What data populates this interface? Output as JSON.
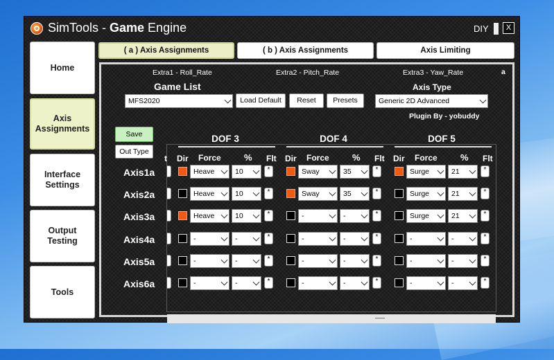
{
  "window": {
    "title_part1": "SimTools - ",
    "title_part2": "Game",
    "title_part3": " Engine",
    "diy_label": "DIY",
    "close_label": "X",
    "accent_color": "#f25a14"
  },
  "sidebar": {
    "items": [
      {
        "label": "Home"
      },
      {
        "label": "Axis Assignments"
      },
      {
        "label": "Interface Settings"
      },
      {
        "label": "Output Testing"
      },
      {
        "label": "Tools"
      }
    ]
  },
  "tabs": [
    {
      "label": "( a ) Axis Assignments",
      "active": true
    },
    {
      "label": "( b ) Axis Assignments",
      "active": false
    },
    {
      "label": "Axis Limiting",
      "active": false
    }
  ],
  "extras": {
    "extra1": "Extra1 - Roll_Rate",
    "extra2": "Extra2 - Pitch_Rate",
    "extra3": "Extra3 - Yaw_Rate",
    "corner": "a"
  },
  "game_list": {
    "label": "Game List",
    "value": "MFS2020",
    "load_default": "Load Default",
    "reset": "Reset",
    "presets": "Presets"
  },
  "axis_type": {
    "label": "Axis Type",
    "value": "Generic 2D Advanced",
    "plugin_by": "Plugin By - yobuddy"
  },
  "buttons": {
    "save": "Save",
    "out_type": "Out Type"
  },
  "columns": {
    "dir": "Dir",
    "force": "Force",
    "percent": "%",
    "flt": "Flt",
    "cut": "t"
  },
  "dofs": [
    "DOF 3",
    "DOF 4",
    "DOF 5"
  ],
  "flt_symbol": "*",
  "axes": [
    {
      "label": "Axis1a",
      "cells": [
        {
          "dir": true,
          "force": "Heave",
          "pct": "10"
        },
        {
          "dir": true,
          "force": "Sway",
          "pct": "35"
        },
        {
          "dir": true,
          "force": "Surge",
          "pct": "21"
        }
      ]
    },
    {
      "label": "Axis2a",
      "cells": [
        {
          "dir": false,
          "force": "Heave",
          "pct": "10"
        },
        {
          "dir": true,
          "force": "Sway",
          "pct": "35"
        },
        {
          "dir": false,
          "force": "Surge",
          "pct": "21"
        }
      ]
    },
    {
      "label": "Axis3a",
      "cells": [
        {
          "dir": true,
          "force": "Heave",
          "pct": "10"
        },
        {
          "dir": false,
          "force": "-",
          "pct": "-"
        },
        {
          "dir": false,
          "force": "Surge",
          "pct": "21"
        }
      ]
    },
    {
      "label": "Axis4a",
      "cells": [
        {
          "dir": false,
          "force": "-",
          "pct": "-"
        },
        {
          "dir": false,
          "force": "-",
          "pct": "-"
        },
        {
          "dir": false,
          "force": "-",
          "pct": "-"
        }
      ]
    },
    {
      "label": "Axis5a",
      "cells": [
        {
          "dir": false,
          "force": "-",
          "pct": "-"
        },
        {
          "dir": false,
          "force": "-",
          "pct": "-"
        },
        {
          "dir": false,
          "force": "-",
          "pct": "-"
        }
      ]
    },
    {
      "label": "Axis6a",
      "cells": [
        {
          "dir": false,
          "force": "-",
          "pct": "-"
        },
        {
          "dir": false,
          "force": "-",
          "pct": "-"
        },
        {
          "dir": false,
          "force": "-",
          "pct": "-"
        }
      ]
    }
  ]
}
